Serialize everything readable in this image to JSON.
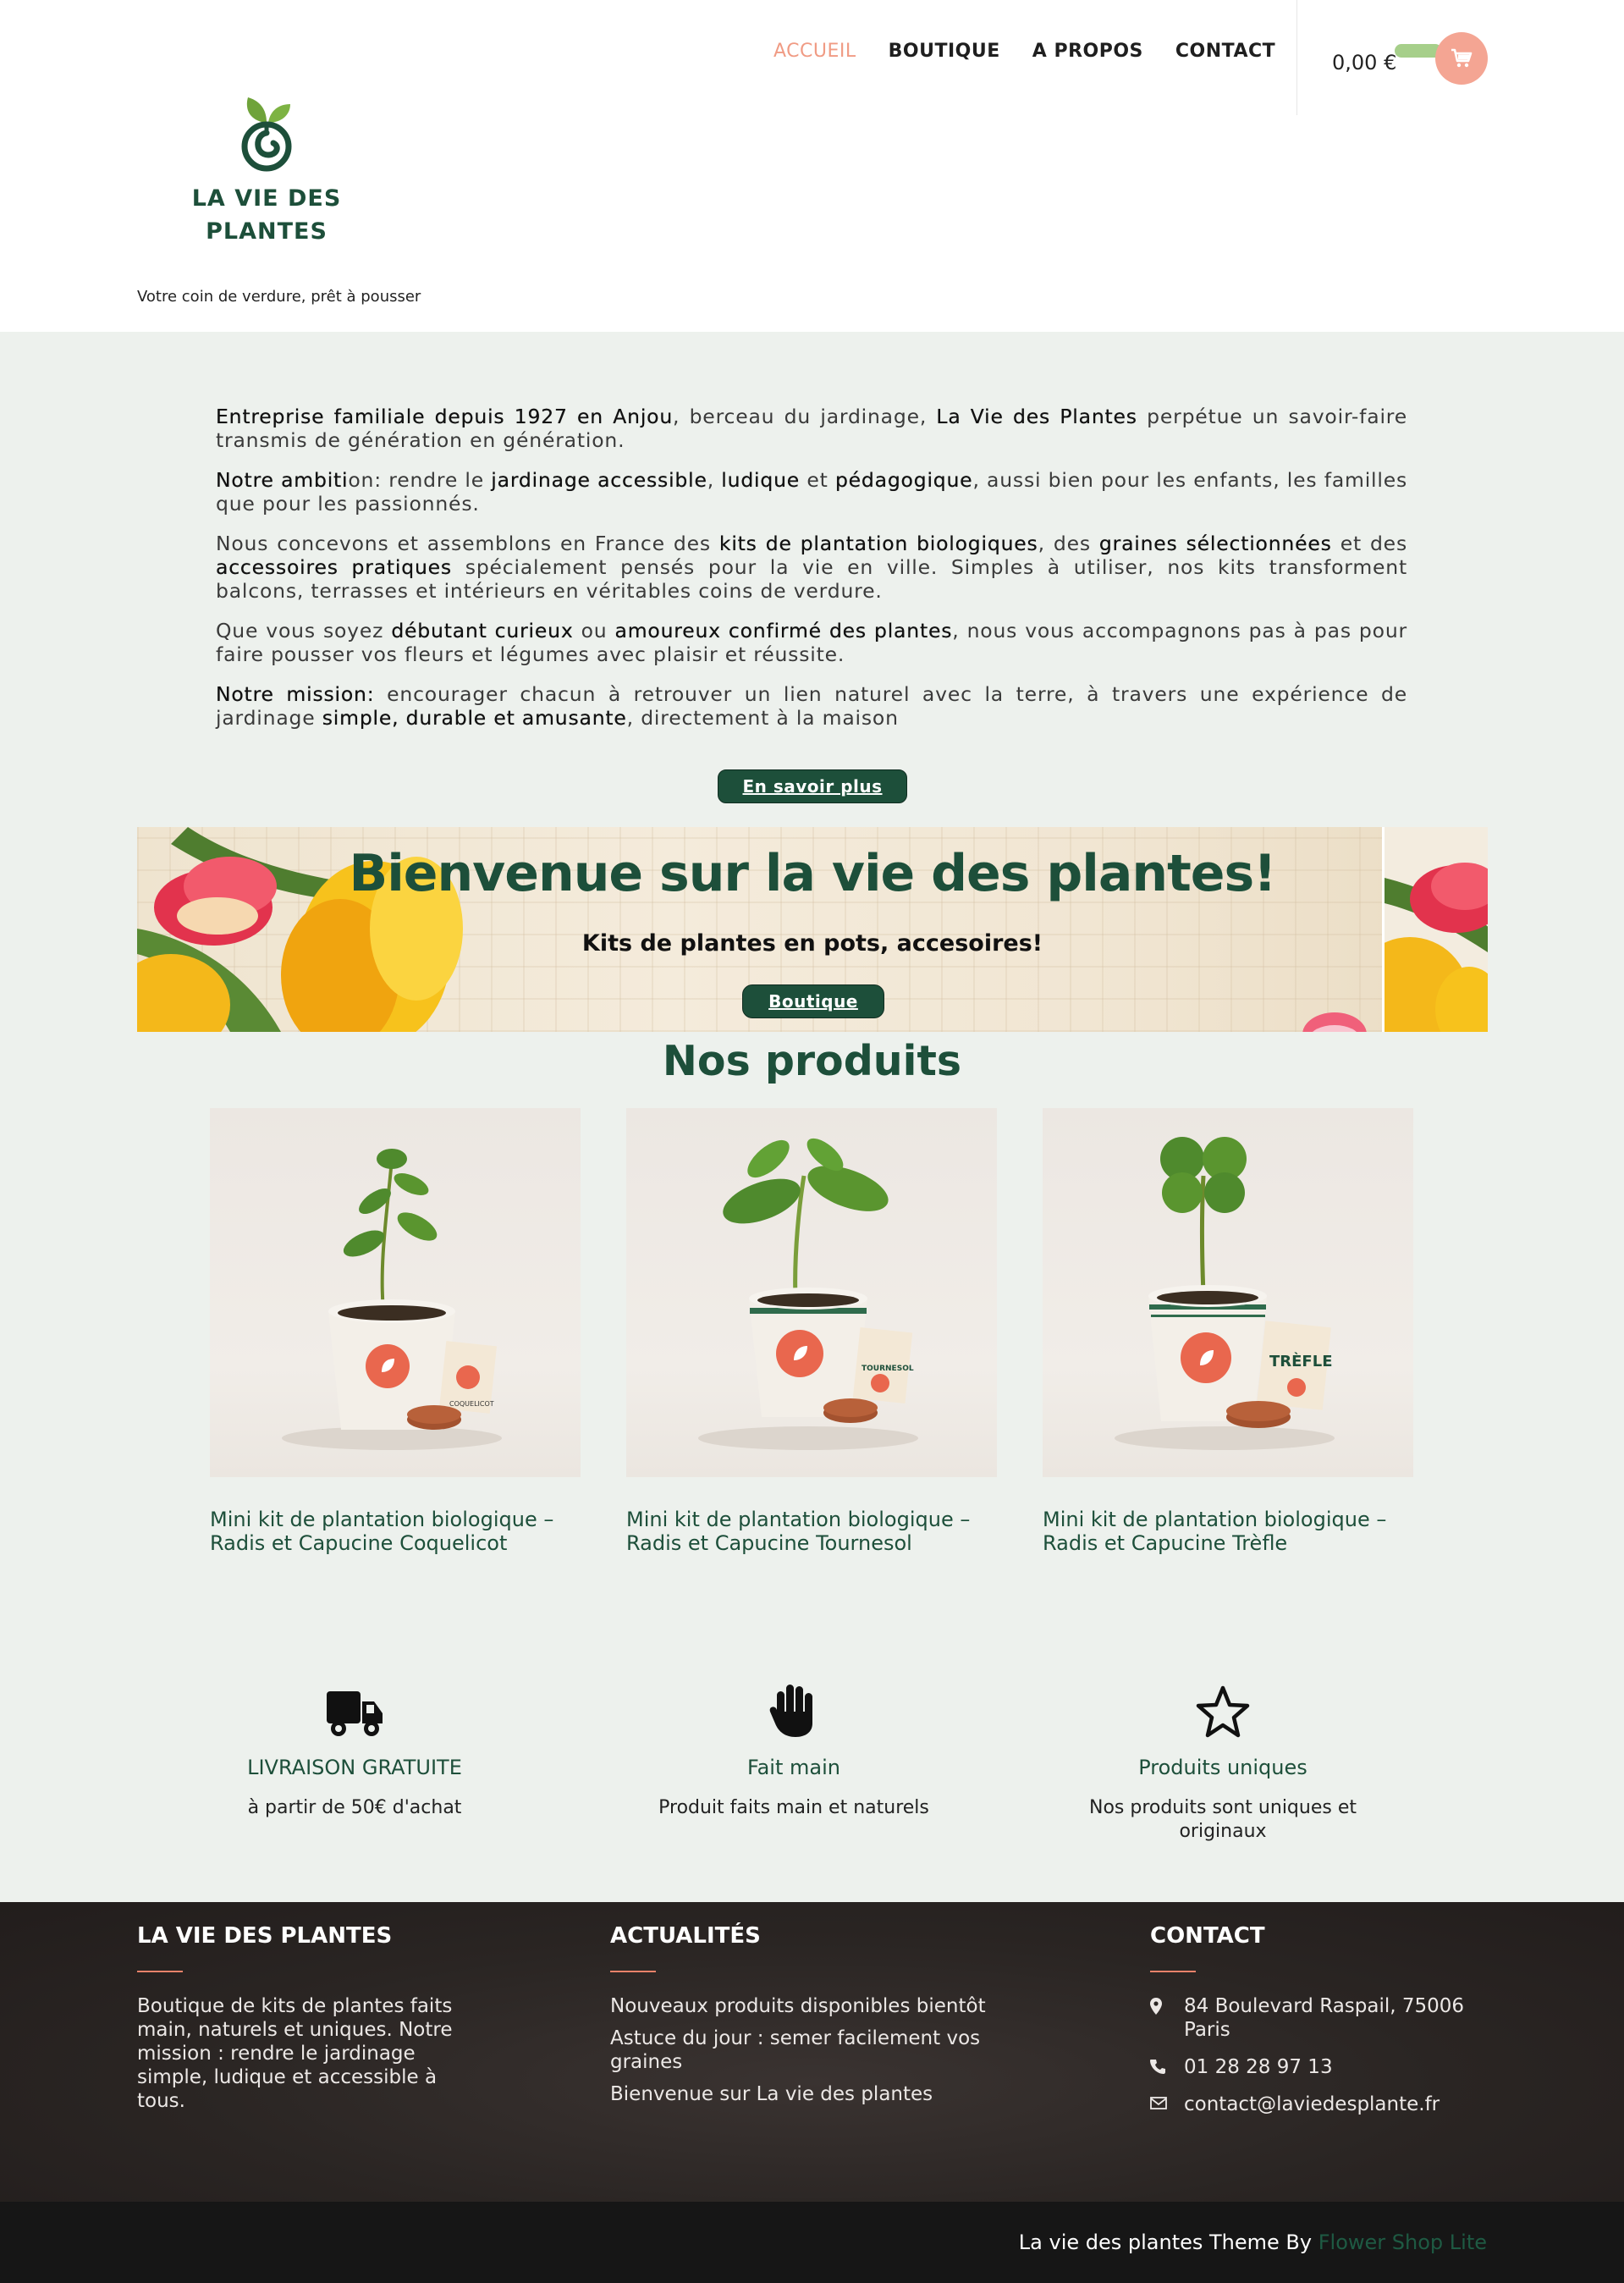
{
  "brand": {
    "logo_line1": "LA VIE DES",
    "logo_line2": "PLANTES",
    "tagline": "Votre coin de verdure, prêt à pousser"
  },
  "nav": [
    "ACCUEIL",
    "BOUTIQUE",
    "A PROPOS",
    "CONTACT"
  ],
  "cart": {
    "total": "0,00 €"
  },
  "intro": {
    "p1": [
      {
        "t": "Entreprise familiale depuis 1927 en Anjou",
        "b": true
      },
      {
        "t": ", berceau du jardinage, ",
        "b": false
      },
      {
        "t": "La Vie des Plantes",
        "b": true
      },
      {
        "t": " perpétue un savoir-faire transmis de génération en génération.",
        "b": false
      }
    ],
    "p2": [
      {
        "t": "Notre ambiti",
        "b": true
      },
      {
        "t": "on: rendre le ",
        "b": false
      },
      {
        "t": "jardinage accessible",
        "b": true
      },
      {
        "t": ", ",
        "b": false
      },
      {
        "t": "ludique",
        "b": true
      },
      {
        "t": " et ",
        "b": false
      },
      {
        "t": "pédagogique",
        "b": true
      },
      {
        "t": ", aussi bien pour les enfants, les familles que pour les passionnés.",
        "b": false
      }
    ],
    "p3": [
      {
        "t": "Nous concevons et assemblons en France des ",
        "b": false
      },
      {
        "t": "kits de plantation biologiques",
        "b": true
      },
      {
        "t": ", des ",
        "b": false
      },
      {
        "t": "graines sélectionnées",
        "b": true
      },
      {
        "t": " et des ",
        "b": false
      },
      {
        "t": "accessoires pratiques",
        "b": true
      },
      {
        "t": " spécialement pensés pour la vie en ville. Simples à utiliser, nos kits transforment balcons, terrasses et intérieurs en véritables coins de verdure.",
        "b": false
      }
    ],
    "p4": [
      {
        "t": "Que vous soyez ",
        "b": false
      },
      {
        "t": "débutant curieux",
        "b": true
      },
      {
        "t": " ou ",
        "b": false
      },
      {
        "t": "amoureux confirmé des plantes",
        "b": true
      },
      {
        "t": ", nous vous accompagnons pas à pas pour faire pousser vos fleurs et légumes avec plaisir et réussite.",
        "b": false
      }
    ],
    "p5": [
      {
        "t": "Notre mission:",
        "b": true
      },
      {
        "t": " encourager chacun à retrouver un lien naturel avec la terre, à travers une expérience de jardinage ",
        "b": false
      },
      {
        "t": "simple, durable et amusante",
        "b": true
      },
      {
        "t": ", directement à la maison",
        "b": false
      }
    ],
    "button": "En savoir plus"
  },
  "banner": {
    "title": "Bienvenue sur la vie des plantes!",
    "subtitle": "Kits de plantes en pots, accesoires!",
    "button": "Boutique"
  },
  "products": {
    "title": "Nos produits",
    "items": [
      {
        "name": "Mini kit de plantation biologique – Radis et Capucine Coquelicot",
        "label": "COQUELICOT"
      },
      {
        "name": "Mini kit de plantation biologique – Radis et Capucine Tournesol",
        "label": "TOURNESOL"
      },
      {
        "name": "Mini kit de plantation biologique – Radis et Capucine Trèfle",
        "label": "TRÈFLE"
      }
    ]
  },
  "features": [
    {
      "icon": "truck-icon",
      "title": "LIVRAISON GRATUITE",
      "text": "à partir de 50€ d'achat"
    },
    {
      "icon": "hand-icon",
      "title": "Fait main",
      "text": "Produit faits main et naturels"
    },
    {
      "icon": "star-icon",
      "title": "Produits uniques",
      "text": "Nos produits sont uniques et originaux"
    }
  ],
  "footer": {
    "about_title": "LA VIE DES PLANTES",
    "about_text": "Boutique de kits de plantes faits main, naturels et uniques. Notre mission : rendre le jardinage simple, ludique et accessible à tous.",
    "news_title": "ACTUALITÉS",
    "news": [
      "Nouveaux produits disponibles bientôt",
      "Astuce du jour : semer facilement vos graines",
      "Bienvenue sur La vie des plantes"
    ],
    "contact_title": "CONTACT",
    "address": "84 Boulevard Raspail, 75006 Paris",
    "phone": "01 28 28 97 13",
    "email": "contact@laviedesplante.fr",
    "credit_text": "La vie des plantes Theme By ",
    "credit_link": "Flower Shop Lite"
  },
  "colors": {
    "brand_green": "#1d4f3a",
    "accent_salmon": "#f09b84",
    "cart_green": "#a6cf8a",
    "page_bg": "#edf1ed",
    "footer_bg": "#2a2523"
  }
}
